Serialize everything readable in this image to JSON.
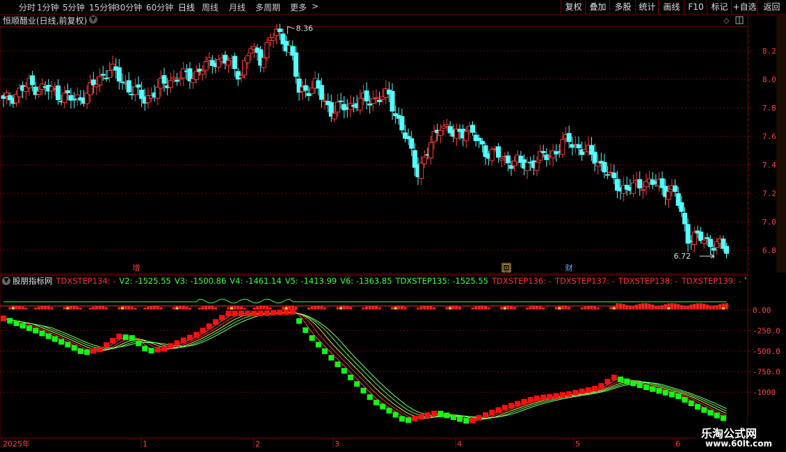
{
  "toolbar": {
    "periods": [
      "分时",
      "1分钟",
      "5分钟",
      "15分钟",
      "30分钟",
      "60分钟",
      "日线",
      "周线",
      "月线",
      "多周期",
      "更多"
    ],
    "active_period": "日线",
    "buttons": [
      "复权",
      "叠加",
      "多股",
      "统计",
      "画线",
      "F10",
      "标记",
      "+自选",
      "返回"
    ]
  },
  "stock": {
    "title": "恒顺醋业(日线,前复权)"
  },
  "price_panel": {
    "high_label": "8.36",
    "low_label": "6.72",
    "y_ticks": [
      "8.20",
      "8.00",
      "7.80",
      "7.60",
      "7.40",
      "7.20",
      "7.00",
      "6.80"
    ],
    "events": [
      {
        "label": "增",
        "color": "#ff4040"
      },
      {
        "label": "回",
        "color": "#e0b040"
      },
      {
        "label": "财",
        "color": "#60b0ff"
      }
    ]
  },
  "indicator": {
    "name": "股朋指标网",
    "y_ticks": [
      "0.00",
      "-250.0",
      "-500.0",
      "-750.0",
      "-1000"
    ],
    "values": [
      {
        "text": "TDXSTEP134: -",
        "color": "#ff3030"
      },
      {
        "text": "V2: -1525.55",
        "color": "#40ff40"
      },
      {
        "text": "V3: -1500.86",
        "color": "#40ff40"
      },
      {
        "text": "V4: -1461.14",
        "color": "#40ff40"
      },
      {
        "text": "V5: -1413.99",
        "color": "#40ff40"
      },
      {
        "text": "V6: -1363.85",
        "color": "#40ff40"
      },
      {
        "text": "TDXSTEP135: -1525.55",
        "color": "#40ff40"
      },
      {
        "text": "TDXSTEP136: -",
        "color": "#ff3030"
      },
      {
        "text": "TDXSTEP137: -",
        "color": "#ff3030"
      },
      {
        "text": "TDXSTEP138: -",
        "color": "#ff3030"
      },
      {
        "text": "TDXSTEP139: -",
        "color": "#ff3030"
      },
      {
        "text": "TDXSTEP",
        "color": "#ffffff"
      }
    ]
  },
  "time_axis": {
    "labels": [
      "2025年",
      "1",
      "2",
      "3",
      "4",
      "5",
      "6"
    ]
  },
  "watermark": {
    "line1": "乐淘公式网",
    "line2": "www.60lt.com"
  },
  "colors": {
    "up": "#ff3b3b",
    "down": "#54ffff",
    "grid": "#7a0000",
    "axis_text": "#ff4040",
    "ind_up": "#ff1010",
    "ind_down": "#10ff10"
  }
}
